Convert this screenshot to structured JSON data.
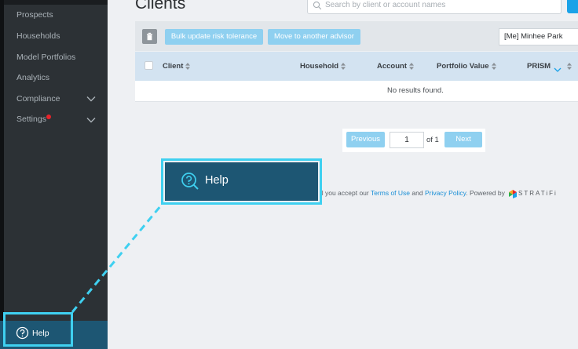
{
  "sidebar": {
    "items": [
      {
        "label": "Prospects"
      },
      {
        "label": "Households"
      },
      {
        "label": "Model Portfolios"
      },
      {
        "label": "Analytics"
      },
      {
        "label": "Compliance"
      },
      {
        "label": "Settings"
      }
    ],
    "help_label": "Help"
  },
  "header": {
    "title": "Clients",
    "search_placeholder": "Search by client or account names"
  },
  "toolbar": {
    "bulk_label": "Bulk update risk tolerance",
    "move_label": "Move to another advisor",
    "advisor_selected": "[Me] Minhee Park"
  },
  "table": {
    "columns": [
      "Client",
      "Household",
      "Account",
      "Portfolio Value",
      "PRISM"
    ],
    "empty_text": "No results found."
  },
  "pagination": {
    "prev_label": "Previous",
    "page": "1",
    "of_text": "of 1",
    "next_label": "Next"
  },
  "footer": {
    "prefix": "al you accept our ",
    "terms": "Terms of Use",
    "and": " and ",
    "privacy": "Privacy Policy",
    "powered": ". Powered by",
    "brand": "STRATiFi"
  },
  "callout": {
    "label": "Help"
  },
  "colors": {
    "sidebar_bg": "#2c3135",
    "accent": "#1aa2e8",
    "highlight": "#3fd0f0",
    "help_bg": "#1d5673",
    "notification": "#e8232a"
  }
}
